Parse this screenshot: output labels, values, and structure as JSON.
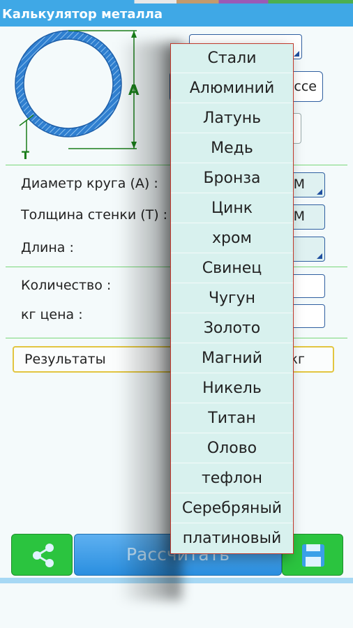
{
  "app": {
    "title": "Калькулятор металла"
  },
  "diagram": {
    "dim_a": "A",
    "dim_t": "T"
  },
  "form": {
    "diameter_label": "Диаметр круга (A) :",
    "thickness_label": "Толщина стенки (T) :",
    "length_label": "Длина :",
    "quantity_label": "Количество :",
    "price_label": "кг цена :",
    "diameter_unit": "M",
    "thickness_unit": "M",
    "button_partial": "ссе"
  },
  "results": {
    "label": "Результаты",
    "unit": "кг"
  },
  "buttons": {
    "calculate": "Рассчитать",
    "share_icon": "share-icon",
    "save_icon": "save-icon"
  },
  "dropdown": {
    "items": [
      "Стали",
      "Алюминий",
      "Латунь",
      "Медь",
      "Бронза",
      "Цинк",
      "хром",
      "Свинец",
      "Чугун",
      "Золото",
      "Магний",
      "Никель",
      "Титан",
      "Олово",
      "тефлон",
      "Серебряный",
      "платиновый"
    ]
  },
  "colors": {
    "accent": "#3fa8e6",
    "green": "#2bc43f",
    "pipe": "#2f7fd0"
  }
}
